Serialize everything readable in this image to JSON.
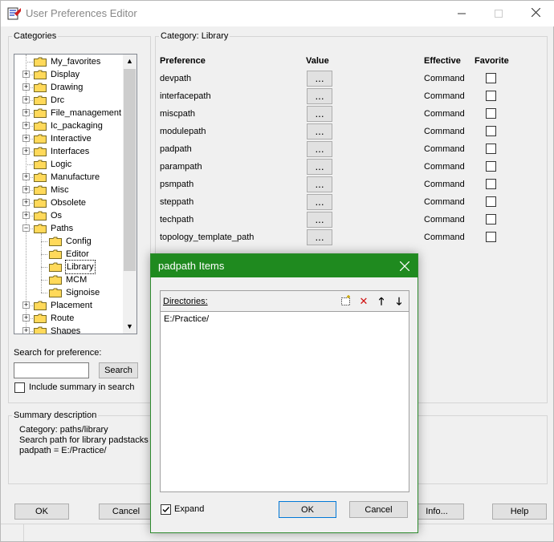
{
  "window": {
    "title": "User Preferences Editor"
  },
  "categories": {
    "label": "Categories",
    "tree": [
      {
        "label": "My_favorites",
        "level": 0,
        "expander": "none"
      },
      {
        "label": "Display",
        "level": 0,
        "expander": "plus"
      },
      {
        "label": "Drawing",
        "level": 0,
        "expander": "plus"
      },
      {
        "label": "Drc",
        "level": 0,
        "expander": "plus"
      },
      {
        "label": "File_management",
        "level": 0,
        "expander": "plus"
      },
      {
        "label": "Ic_packaging",
        "level": 0,
        "expander": "plus"
      },
      {
        "label": "Interactive",
        "level": 0,
        "expander": "plus"
      },
      {
        "label": "Interfaces",
        "level": 0,
        "expander": "plus"
      },
      {
        "label": "Logic",
        "level": 0,
        "expander": "none"
      },
      {
        "label": "Manufacture",
        "level": 0,
        "expander": "plus"
      },
      {
        "label": "Misc",
        "level": 0,
        "expander": "plus"
      },
      {
        "label": "Obsolete",
        "level": 0,
        "expander": "plus"
      },
      {
        "label": "Os",
        "level": 0,
        "expander": "plus"
      },
      {
        "label": "Paths",
        "level": 0,
        "expander": "minus"
      },
      {
        "label": "Config",
        "level": 1,
        "expander": "none"
      },
      {
        "label": "Editor",
        "level": 1,
        "expander": "none"
      },
      {
        "label": "Library",
        "level": 1,
        "expander": "none"
      },
      {
        "label": "MCM",
        "level": 1,
        "expander": "none"
      },
      {
        "label": "Signoise",
        "level": 1,
        "expander": "none"
      },
      {
        "label": "Placement",
        "level": 0,
        "expander": "plus"
      },
      {
        "label": "Route",
        "level": 0,
        "expander": "plus"
      },
      {
        "label": "Shapes",
        "level": 0,
        "expander": "plus"
      }
    ]
  },
  "search": {
    "label": "Search for preference:",
    "value": "",
    "button": "Search",
    "include_summary": "Include summary in search"
  },
  "category_panel": {
    "label": "Category:  Library",
    "headers": {
      "preference": "Preference",
      "value": "Value",
      "effective": "Effective",
      "favorite": "Favorite"
    },
    "rows": [
      {
        "name": "devpath",
        "value": "...",
        "effective": "Command"
      },
      {
        "name": "interfacepath",
        "value": "...",
        "effective": "Command"
      },
      {
        "name": "miscpath",
        "value": "...",
        "effective": "Command"
      },
      {
        "name": "modulepath",
        "value": "...",
        "effective": "Command"
      },
      {
        "name": "padpath",
        "value": "...",
        "effective": "Command"
      },
      {
        "name": "parampath",
        "value": "...",
        "effective": "Command"
      },
      {
        "name": "psmpath",
        "value": "...",
        "effective": "Command"
      },
      {
        "name": "steppath",
        "value": "...",
        "effective": "Command"
      },
      {
        "name": "techpath",
        "value": "...",
        "effective": "Command"
      },
      {
        "name": "topology_template_path",
        "value": "...",
        "effective": "Command"
      }
    ]
  },
  "summary": {
    "label": "Summary description",
    "line1": "Category: paths/library",
    "line2": "Search path for library padstacks (.",
    "line3": "padpath = E:/Practice/"
  },
  "footer": {
    "ok": "OK",
    "cancel": "Cancel",
    "info": "Info...",
    "help": "Help"
  },
  "dialog": {
    "title": "padpath Items",
    "directories_label": "Directories:",
    "directories": [
      "E:/Practice/"
    ],
    "expand": "Expand",
    "ok": "OK",
    "cancel": "Cancel"
  },
  "colors": {
    "dialog_titlebar": "#1f8a1f",
    "window_bg": "#f0f0f0"
  }
}
